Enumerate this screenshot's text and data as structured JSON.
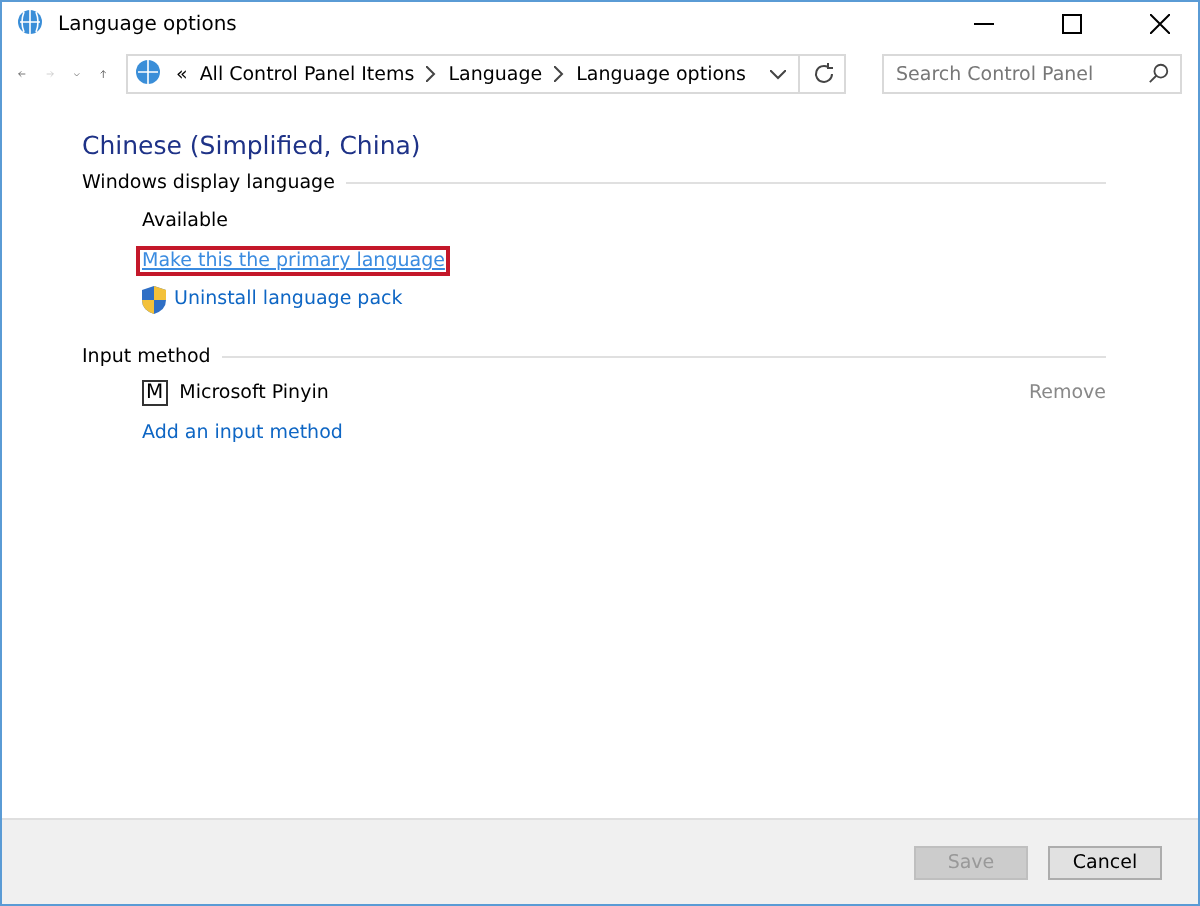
{
  "window": {
    "title": "Language options"
  },
  "nav": {
    "back_disabled": false,
    "forward_disabled": true,
    "breadcrumb": [
      {
        "label": "«"
      },
      {
        "label": "All Control Panel Items"
      },
      {
        "label": "Language"
      },
      {
        "label": "Language options"
      }
    ],
    "search": {
      "placeholder": "Search Control Panel"
    }
  },
  "heading": "Chinese (Simplified, China)",
  "display_language": {
    "title": "Windows display language",
    "status": "Available",
    "actions": [
      {
        "kind": "link",
        "label": "Make this the primary language",
        "highlighted": true
      },
      {
        "kind": "shield-link",
        "label": "Uninstall language pack",
        "highlighted": false
      }
    ]
  },
  "input_method": {
    "title": "Input method",
    "methods": [
      {
        "icon_letter": "M",
        "name": "Microsoft Pinyin",
        "remove": {
          "label": "Remove",
          "disabled": true
        }
      }
    ],
    "add_link": "Add an input method"
  },
  "buttons": [
    {
      "label": "Save",
      "disabled": true
    },
    {
      "label": "Cancel",
      "disabled": false
    }
  ]
}
